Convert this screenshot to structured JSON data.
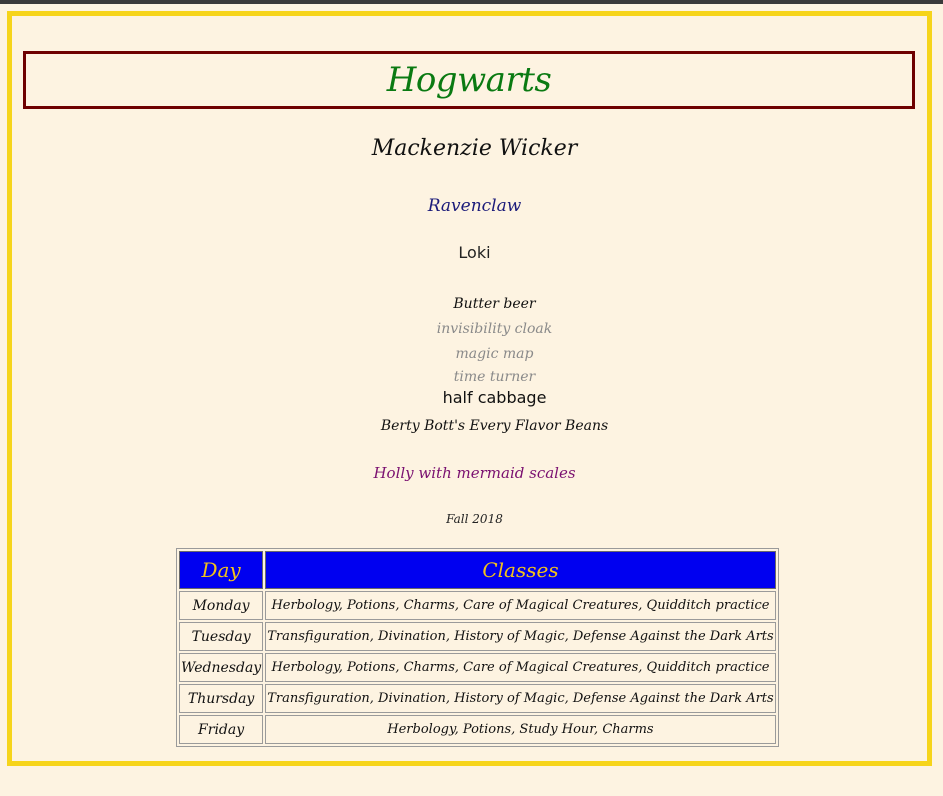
{
  "page": {
    "title": "Hogwarts",
    "student_name": "Mackenzie Wicker",
    "house": "Ravenclaw",
    "pet": "Loki",
    "items": [
      "Butter beer",
      "invisibility cloak",
      "magic map",
      "time turner",
      "half cabbage",
      "Berty Bott's Every Flavor Beans"
    ],
    "wand": "Holly with mermaid scales",
    "term": "Fall 2018"
  },
  "schedule": {
    "headers": [
      "Day",
      "Classes"
    ],
    "rows": [
      {
        "day": "Monday",
        "classes": "Herbology, Potions, Charms, Care of Magical Creatures, Quidditch practice"
      },
      {
        "day": "Tuesday",
        "classes": "Transfiguration, Divination, History of Magic, Defense Against the Dark Arts"
      },
      {
        "day": "Wednesday",
        "classes": "Herbology, Potions, Charms, Care of Magical Creatures, Quidditch practice"
      },
      {
        "day": "Thursday",
        "classes": "Transfiguration, Divination, History of Magic, Defense Against the Dark Arts"
      },
      {
        "day": "Friday",
        "classes": "Herbology, Potions, Study Hour, Charms"
      }
    ]
  },
  "colors": {
    "background": "#fdf3e1",
    "frame_border": "#f6d41a",
    "title_border": "#6e0000",
    "title_text": "#0a7a12",
    "house_text": "#1b1b7a",
    "wand_text": "#7a1070",
    "header_bg": "#0000f0",
    "header_text": "#f2c21b"
  }
}
